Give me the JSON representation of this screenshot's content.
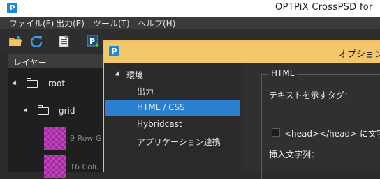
{
  "app": {
    "title": "OPTPiX CrossPSD for",
    "logo_text": "P"
  },
  "menu": {
    "items": [
      {
        "label": "ファイル(F)"
      },
      {
        "label": "出力(E)"
      },
      {
        "label": "ツール(T)"
      },
      {
        "label": "ヘルプ(H)"
      }
    ]
  },
  "toolbar": {
    "icons": [
      "open-folder-icon",
      "refresh-icon",
      "export-document-icon",
      "preview-icon"
    ]
  },
  "layers": {
    "title": "レイヤー",
    "items": [
      {
        "label": "root",
        "type": "folder",
        "expanded": true
      },
      {
        "label": "grid",
        "type": "folder",
        "expanded": true
      },
      {
        "label": "9 Row G",
        "type": "layer"
      },
      {
        "label": "16 Colu",
        "type": "layer"
      }
    ]
  },
  "dialog": {
    "title": "オプション",
    "logo_text": "P",
    "nav": {
      "group": "環境",
      "items": [
        {
          "label": "出力",
          "selected": false
        },
        {
          "label": "HTML / CSS",
          "selected": true
        },
        {
          "label": "Hybridcast",
          "selected": false
        },
        {
          "label": "アプリケーション連携",
          "selected": false
        }
      ]
    },
    "html_settings": {
      "group_title": "HTML",
      "tag_label": "テキストを示すタグ：",
      "head_checkbox_label": "<head></head> に文字列",
      "head_checkbox_checked": false,
      "insert_label": "挿入文字列："
    }
  },
  "colors": {
    "accent_selection": "#2b7fd0",
    "dialog_titlebar": "#f3c76a",
    "app_logo": "#1e88d8"
  }
}
